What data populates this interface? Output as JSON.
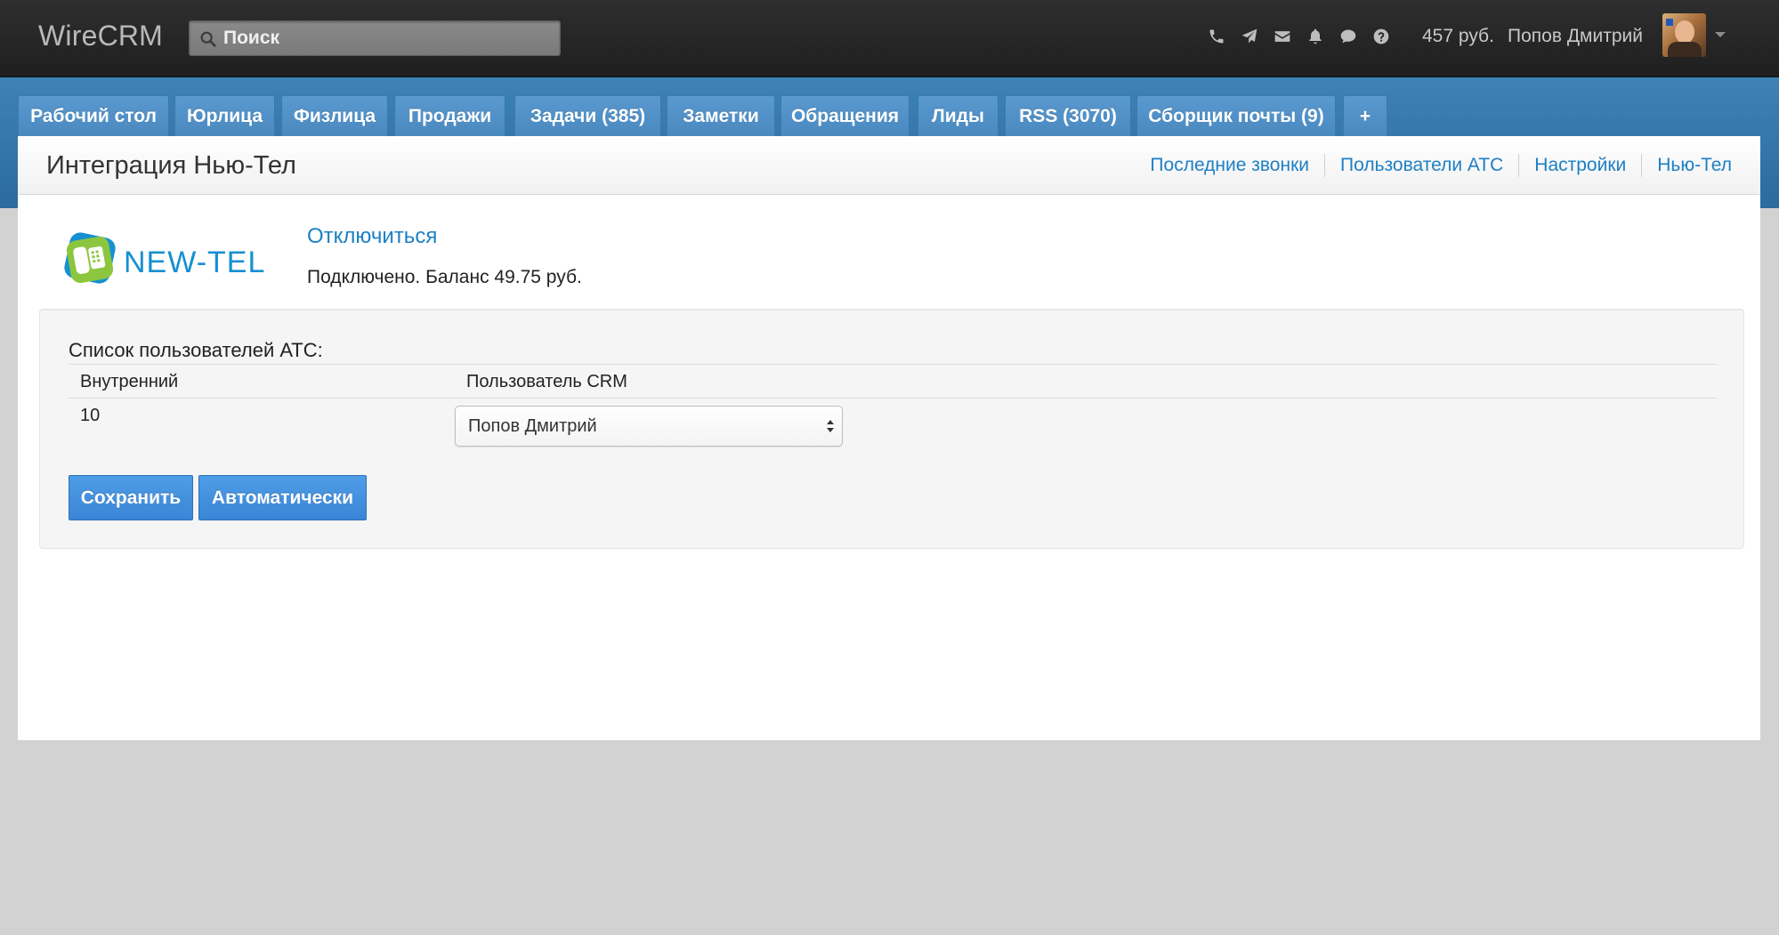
{
  "app": {
    "brand": "WireCRM"
  },
  "search": {
    "placeholder": "Поиск"
  },
  "top_icons": [
    "phone-icon",
    "send-icon",
    "mail-icon",
    "bell-icon",
    "chat-icon",
    "help-icon"
  ],
  "account": {
    "balance": "457 руб.",
    "user_name": "Попов Дмитрий"
  },
  "tabs": [
    {
      "label": "Рабочий стол"
    },
    {
      "label": "Юрлица"
    },
    {
      "label": "Физлица"
    },
    {
      "label": "Продажи"
    },
    {
      "label": "Задачи (385)"
    },
    {
      "label": "Заметки"
    },
    {
      "label": "Обращения"
    },
    {
      "label": "Лиды"
    },
    {
      "label": "RSS (3070)"
    },
    {
      "label": "Сборщик почты (9)"
    },
    {
      "label": "+"
    }
  ],
  "page": {
    "title": "Интеграция Нью-Тел",
    "subnav": [
      {
        "label": "Последние звонки"
      },
      {
        "label": "Пользователи АТС"
      },
      {
        "label": "Настройки"
      },
      {
        "label": "Нью-Тел"
      }
    ]
  },
  "integration": {
    "logo_text": "NEW-TEL",
    "disconnect_label": "Отключиться",
    "status_text": "Подключено. Баланс 49.75 руб."
  },
  "pbx_users": {
    "title": "Список пользователей АТС:",
    "columns": [
      "Внутренний",
      "Пользователь CRM"
    ],
    "rows": [
      {
        "extension": "10",
        "crm_user": "Попов Дмитрий"
      }
    ],
    "save_label": "Сохранить",
    "auto_label": "Автоматически"
  },
  "colors": {
    "topbar": "#262626",
    "band": "#3578ac",
    "tab": "#5294c9",
    "link": "#1d7fc4",
    "button": "#4591df",
    "logo_green": "#8cc63f",
    "logo_blue": "#1590d1"
  }
}
